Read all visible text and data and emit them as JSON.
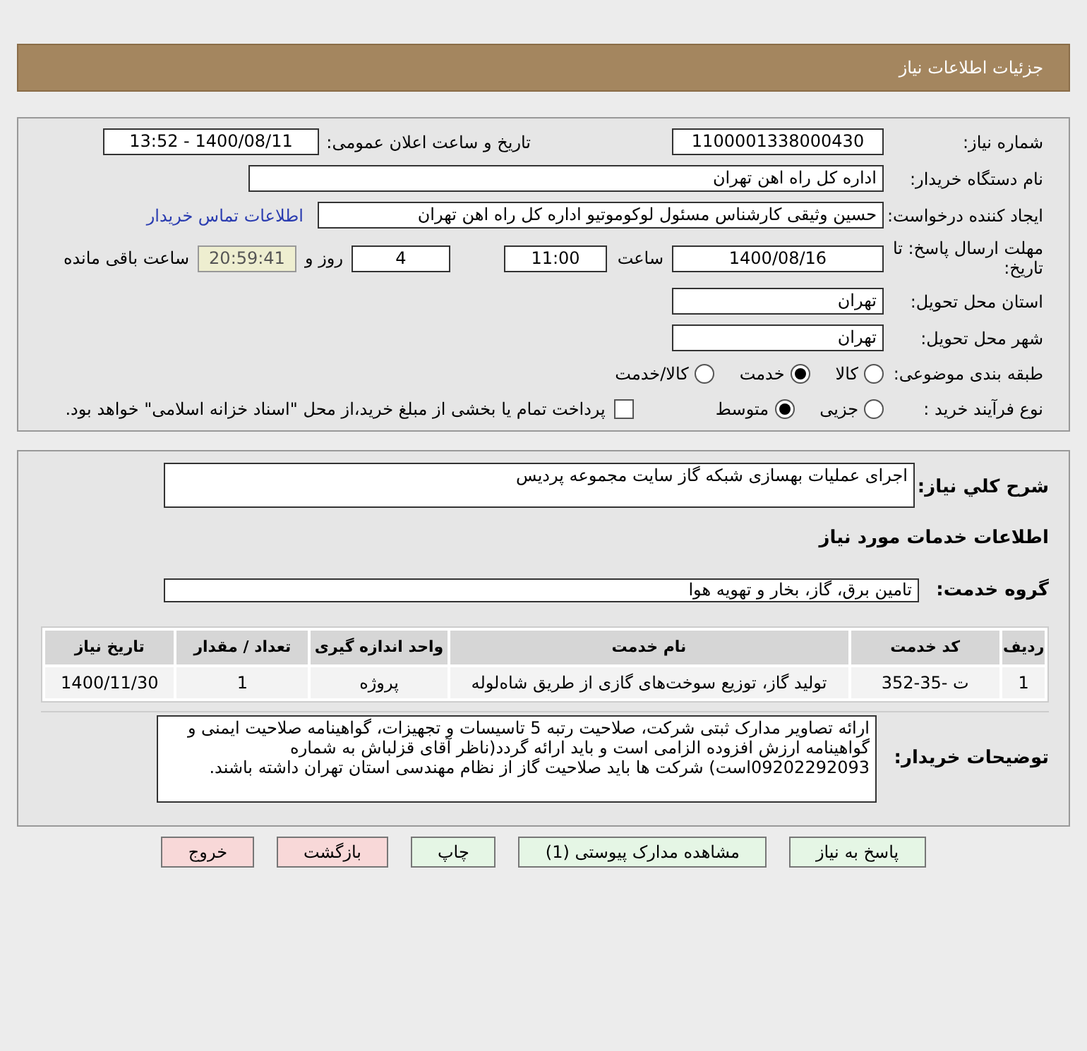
{
  "header": {
    "title": "جزئیات اطلاعات نیاز"
  },
  "details": {
    "need_number": {
      "label": "شماره نیاز:",
      "value": "1100001338000430"
    },
    "announce": {
      "label": "تاریخ و ساعت اعلان عمومی:",
      "value": "1400/08/11 - 13:52"
    },
    "buyer": {
      "label": "نام دستگاه خریدار:",
      "value": "اداره کل راه اهن تهران"
    },
    "requester": {
      "label": "ایجاد کننده درخواست:",
      "value": "حسین وثیقی کارشناس مسئول لوکوموتیو اداره کل راه اهن تهران",
      "link": "اطلاعات تماس خریدار"
    },
    "deadline": {
      "label": "مهلت ارسال پاسخ: تا تاریخ:",
      "date": "1400/08/16",
      "time_label": "ساعت",
      "time": "11:00",
      "days": "4",
      "days_label": "روز و",
      "remaining": "20:59:41",
      "remaining_label": "ساعت باقی مانده"
    },
    "province": {
      "label": "استان محل تحویل:",
      "value": "تهران"
    },
    "city": {
      "label": "شهر محل تحویل:",
      "value": "تهران"
    },
    "category": {
      "label": "طبقه بندی موضوعی:",
      "options": [
        {
          "label": "کالا",
          "selected": false
        },
        {
          "label": "خدمت",
          "selected": true
        },
        {
          "label": "کالا/خدمت",
          "selected": false
        }
      ]
    },
    "process": {
      "label": "نوع فرآیند خرید :",
      "options": [
        {
          "label": "جزیی",
          "selected": false
        },
        {
          "label": "متوسط",
          "selected": true
        }
      ],
      "treasury": {
        "label": "پرداخت تمام یا بخشی از مبلغ خرید،از محل \"اسناد خزانه اسلامی\" خواهد بود.",
        "checked": false
      }
    }
  },
  "summary": {
    "label": "شرح كلي نياز:",
    "value": "اجرای عملیات بهسازی شبکه گاز سایت مجموعه پردیس"
  },
  "services_title": "اطلاعات خدمات مورد نياز",
  "service_group": {
    "label": "گروه خدمت:",
    "value": "تامین برق، گاز، بخار و تهویه هوا"
  },
  "table": {
    "columns": [
      "ردیف",
      "کد خدمت",
      "نام خدمت",
      "واحد اندازه گیری",
      "تعداد / مقدار",
      "تاریخ نیاز"
    ],
    "rows": [
      [
        "1",
        "ت -35-352",
        "تولید گاز، توزیع سوخت‌های گازی از طریق شاه‌لوله",
        "پروژه",
        "1",
        "1400/11/30"
      ]
    ]
  },
  "buyer_notes": {
    "label": "توضیحات خریدار:",
    "value": "ارائه تصاویر مدارک ثبتی شرکت، صلاحیت رتبه 5 تاسیسات و تجهیزات، گواهینامه صلاحیت ایمنی و گواهینامه ارزش افزوده الزامی است و باید ارائه گردد(ناظر آقای قزلباش به شماره 09202292093است) شرکت ها باید صلاحیت گاز از نظام مهندسی استان تهران داشته باشند."
  },
  "buttons": [
    {
      "label": "پاسخ به نیاز",
      "kind": "primary"
    },
    {
      "label": "مشاهده مدارک پیوستی (1)",
      "kind": "primary"
    },
    {
      "label": "چاپ",
      "kind": "primary"
    },
    {
      "label": "بازگشت",
      "kind": "danger"
    },
    {
      "label": "خروج",
      "kind": "danger"
    }
  ]
}
